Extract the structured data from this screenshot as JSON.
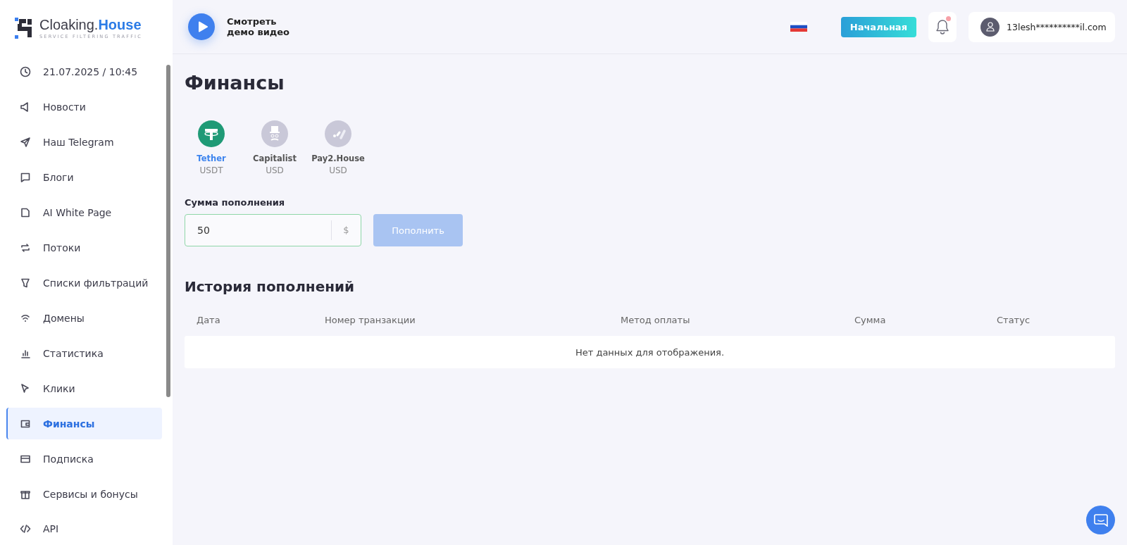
{
  "logo": {
    "name": "Cloaking.",
    "name_accent": "House",
    "tagline": "SERVICE FILTERING TRAFFIC"
  },
  "sidebar": {
    "items": [
      {
        "label": "21.07.2025 / 10:45",
        "selected": false
      },
      {
        "label": "Новости",
        "selected": false
      },
      {
        "label": "Наш Telegram",
        "selected": false
      },
      {
        "label": "Блоги",
        "selected": false
      },
      {
        "label": "AI White Page",
        "selected": false
      },
      {
        "label": "Потоки",
        "selected": false
      },
      {
        "label": "Списки фильтраций",
        "selected": false
      },
      {
        "label": "Домены",
        "selected": false
      },
      {
        "label": "Статистика",
        "selected": false
      },
      {
        "label": "Клики",
        "selected": false
      },
      {
        "label": "Финансы",
        "selected": true
      },
      {
        "label": "Подписка",
        "selected": false
      },
      {
        "label": "Сервисы и бонусы",
        "selected": false
      },
      {
        "label": "API",
        "selected": false
      }
    ]
  },
  "header": {
    "demo_video": "Смотреть\nдемо видео",
    "plan_button": "Начальная",
    "notifications_unread": true,
    "user_email": "13lesh**********il.com"
  },
  "page_title": "Финансы",
  "payment_methods": [
    {
      "name": "Tether",
      "currency": "USDT",
      "selected": true
    },
    {
      "name": "Capitalist",
      "currency": "USD",
      "selected": false
    },
    {
      "name": "Pay2.House",
      "currency": "USD",
      "selected": false
    }
  ],
  "amount": {
    "label": "Сумма пополнения",
    "value": "50",
    "unit": "$"
  },
  "submit_button": {
    "label": "Пополнить",
    "disabled": true
  },
  "history": {
    "title": "История пополнений",
    "columns": [
      "Дата",
      "Номер транзакции",
      "Метод оплаты",
      "Сумма",
      "Статус"
    ],
    "empty_message": "Нет данных для отображения."
  }
}
